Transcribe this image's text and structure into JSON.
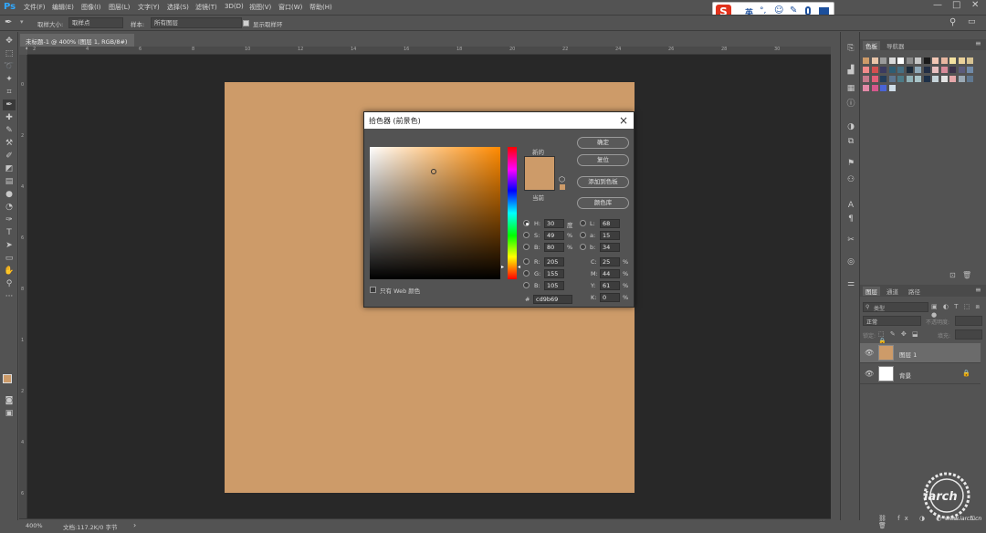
{
  "app": {
    "logo": "Ps",
    "menus": [
      "文件(F)",
      "编辑(E)",
      "图像(I)",
      "图层(L)",
      "文字(Y)",
      "选择(S)",
      "滤镜(T)",
      "3D(D)",
      "视图(V)",
      "窗口(W)",
      "帮助(H)"
    ]
  },
  "ime": {
    "logo": "S",
    "mode": "英"
  },
  "window_controls": [
    "—",
    "□",
    "✕"
  ],
  "options_bar": {
    "size_label": "取样大小:",
    "size_value": "取样点",
    "sample_label": "样本:",
    "sample_value": "所有图层",
    "show_ring_label": "显示取样环"
  },
  "document": {
    "tab_title": "未标题-1 @ 400% (图层 1, RGB/8#) *",
    "zoom": "400%",
    "doc_info": "文档:117.2K/0 字节",
    "canvas_color": "#cd9b69"
  },
  "ruler_ticks_top": [
    "2",
    "4",
    "6",
    "8",
    "10",
    "12",
    "14",
    "16",
    "18",
    "20",
    "22",
    "24",
    "26",
    "28",
    "30"
  ],
  "ruler_ticks_left": [
    "0",
    "2",
    "4",
    "6",
    "8",
    "1",
    "2",
    "4",
    "6"
  ],
  "color_picker": {
    "title": "拾色器 (前景色)",
    "ok": "确定",
    "reset": "复位",
    "add_swatch": "添加到色板",
    "color_libraries": "颜色库",
    "new_label": "新的",
    "current_label": "当前",
    "web_only": "只有 Web 颜色",
    "new_color": "#cd9b69",
    "current_color": "#cd9b69",
    "hsb": {
      "h_label": "H:",
      "h": "30",
      "h_unit": "度",
      "s_label": "S:",
      "s": "49",
      "s_unit": "%",
      "b_label": "B:",
      "b": "80",
      "b_unit": "%"
    },
    "rgb": {
      "r_label": "R:",
      "r": "205",
      "g_label": "G:",
      "g": "155",
      "b_label": "B:",
      "b": "105"
    },
    "lab": {
      "l_label": "L:",
      "l": "68",
      "a_label": "a:",
      "a": "15",
      "b_label": "b:",
      "b": "34"
    },
    "cmyk": {
      "c_label": "C:",
      "c": "25",
      "m_label": "M:",
      "m": "44",
      "y_label": "Y:",
      "y": "61",
      "k_label": "K:",
      "k": "0",
      "unit": "%"
    },
    "hex_label": "#",
    "hex": "cd9b69"
  },
  "panels": {
    "swatch_tabs": [
      "色板",
      "导航器"
    ],
    "layer_tabs": [
      "图层",
      "通道",
      "路径"
    ],
    "kind": "类型",
    "blend": "正常",
    "opacity_label": "不透明度:",
    "lock_label": "锁定:",
    "fill_label": "填充:",
    "layers": [
      {
        "name": "图层 1",
        "thumb": "#cd9b69"
      },
      {
        "name": "背景",
        "thumb": "#ffffff"
      }
    ]
  },
  "swatches": [
    "#cd9b69",
    "#e8c4a8",
    "#9a9a9a",
    "#d9d9d9",
    "#ffffff",
    "#8a8a8a",
    "#c6c6c6",
    "#1a1a1a",
    "#f2c6b4",
    "#e7b6a0",
    "#f4e1a0",
    "#ead19a",
    "#d7c392",
    "#f28b8b",
    "#d35050",
    "#3b3b60",
    "#2f5d73",
    "#456e82",
    "#1b2a3a",
    "#8fa9b9",
    "#222e44",
    "#e9c0c0",
    "#d88a99",
    "#3b3148",
    "#5c5c7c",
    "#708aa8",
    "#c67a8c",
    "#e35f79",
    "#233d5b",
    "#5d7691",
    "#4c7a86",
    "#90b2b8",
    "#a8c4c8",
    "#1d3048",
    "#c6d4d9",
    "#e3e3e3",
    "#e5a7a9",
    "#9aa9b5",
    "#607890",
    "#e28aa8",
    "#d6578c",
    "#4a64d5",
    "#cfdde8"
  ],
  "watermark": {
    "main": "iarch",
    "sub": "www.iarch.cn"
  }
}
